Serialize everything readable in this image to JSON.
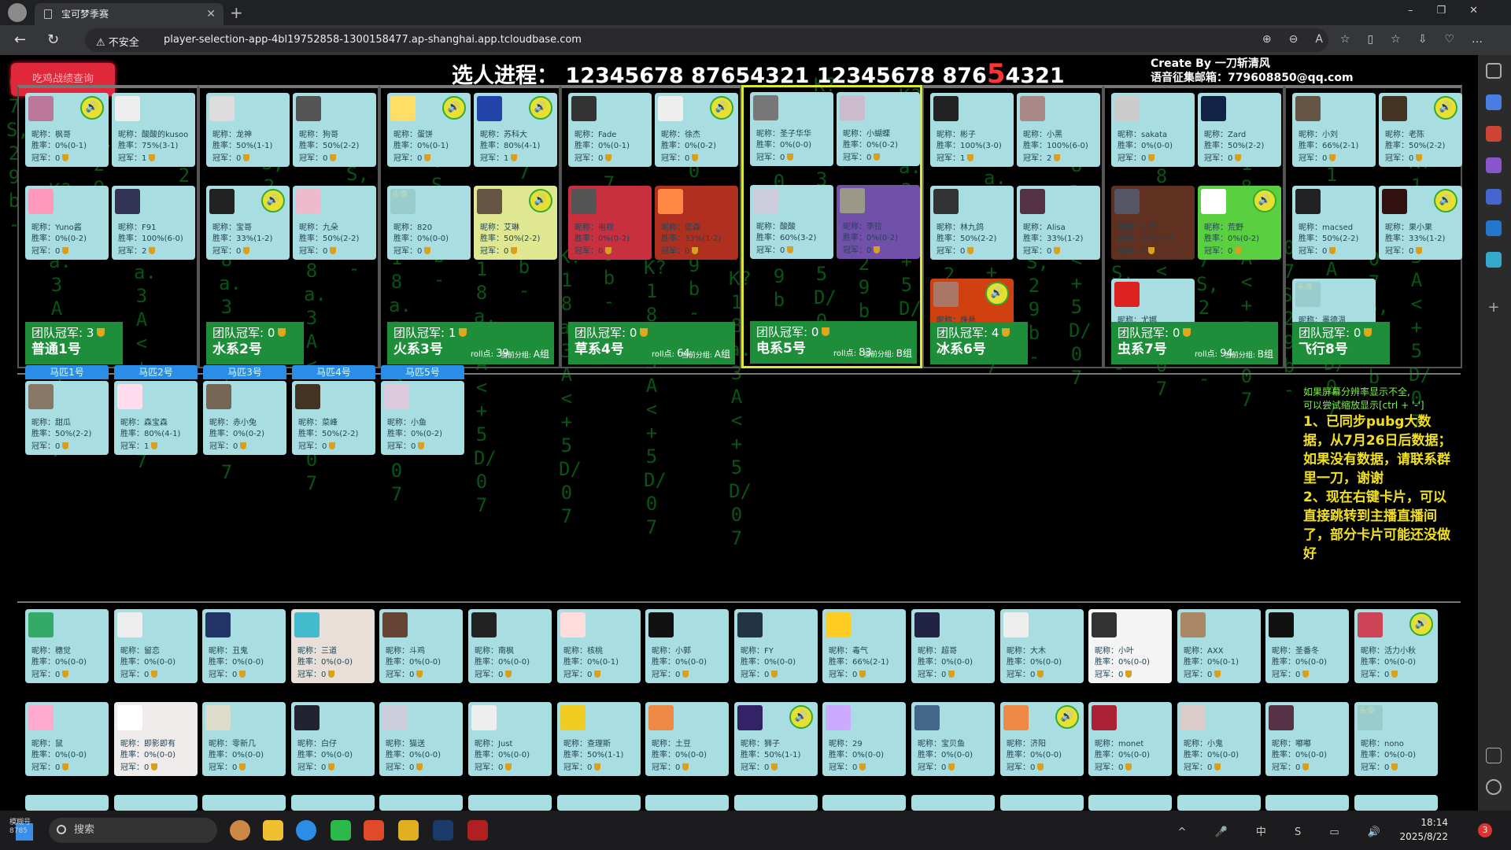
{
  "browser": {
    "tab_title": "宝可梦季赛",
    "insecure_label": "不安全",
    "url": "player-selection-app-4bl19752858-1300158477.ap-shanghai.app.tcloudbase.com"
  },
  "page": {
    "query_button": "吃鸡战绩查询",
    "progress_label": "选人进程：",
    "progress_a": "12345678 87654321 12345678 876",
    "progress_b": "5",
    "progress_c": "4321",
    "credit_1": "Create By 一刀斩清风",
    "credit_2": "语音征集邮箱：779608850@qq.com",
    "stat_labels": {
      "nick": "昵称：",
      "win": "胜率：",
      "champ": "冠军："
    },
    "roll_label": "roll点:",
    "group_label": "当前分组:"
  },
  "teams": [
    {
      "champ": "团队冠军: 3",
      "name": "普通1号",
      "roll": "",
      "group": "",
      "cards": [
        {
          "nick": "枫哥",
          "win": "0%(0-1)",
          "champ": "0",
          "av": "#b79",
          "spk": true
        },
        {
          "nick": "酸酸的kusoo",
          "win": "75%(3-1)",
          "champ": "1",
          "av": "#eee"
        },
        {
          "nick": "Yuno酱",
          "win": "0%(0-2)",
          "champ": "0",
          "av": "#f9b"
        },
        {
          "nick": "F91",
          "win": "100%(6-0)",
          "champ": "2",
          "av": "#335"
        }
      ]
    },
    {
      "champ": "团队冠军: 0",
      "name": "水系2号",
      "roll": "",
      "group": "",
      "cards": [
        {
          "nick": "龙神",
          "win": "50%(1-1)",
          "champ": "0",
          "av": "#ddd"
        },
        {
          "nick": "狗哥",
          "win": "50%(2-2)",
          "champ": "0",
          "av": "#555"
        },
        {
          "nick": "宝哥",
          "win": "33%(1-2)",
          "champ": "0",
          "av": "#222",
          "spk": true
        },
        {
          "nick": "九朵",
          "win": "50%(2-2)",
          "champ": "0",
          "av": "#ebc"
        }
      ]
    },
    {
      "champ": "团队冠军: 1",
      "name": "火系3号",
      "roll": "39",
      "group": "A组",
      "cards": [
        {
          "nick": "蛋饼",
          "win": "0%(0-1)",
          "champ": "0",
          "av": "#fd6",
          "spk": true
        },
        {
          "nick": "苏科大",
          "win": "80%(4-1)",
          "champ": "1",
          "av": "#24a",
          "spk": true
        },
        {
          "nick": "820",
          "win": "0%(0-0)",
          "champ": "0",
          "av": "#9cc",
          "ph": "头像"
        },
        {
          "nick": "艾琳",
          "win": "50%(2-2)",
          "champ": "0",
          "av": "#654",
          "spk": true,
          "bg": "#dfe890"
        }
      ]
    },
    {
      "champ": "团队冠军: 0",
      "name": "草系4号",
      "roll": "64",
      "group": "A组",
      "cards": [
        {
          "nick": "Fade",
          "win": "0%(0-1)",
          "champ": "0",
          "av": "#333"
        },
        {
          "nick": "徐杰",
          "win": "0%(0-2)",
          "champ": "0",
          "av": "#eee",
          "spk": true
        },
        {
          "nick": "电视",
          "win": "0%(0-2)",
          "champ": "0",
          "av": "#555",
          "bg": "#c83040"
        },
        {
          "nick": "蓝森",
          "win": "33%(1-2)",
          "champ": "0",
          "av": "#f84",
          "bg": "#b03020"
        }
      ]
    },
    {
      "champ": "团队冠军: 0",
      "name": "电系5号",
      "roll": "83",
      "group": "B组",
      "active": true,
      "cards": [
        {
          "nick": "圣子华华",
          "win": "0%(0-0)",
          "champ": "0",
          "av": "#777"
        },
        {
          "nick": "小蝴蝶",
          "win": "0%(0-2)",
          "champ": "0",
          "av": "#cbc"
        },
        {
          "nick": "酸酸",
          "win": "60%(3-2)",
          "champ": "0",
          "av": "#ccd"
        },
        {
          "nick": "李拉",
          "win": "0%(0-2)",
          "champ": "0",
          "av": "#998",
          "bg": "#7050a8"
        }
      ]
    },
    {
      "champ": "团队冠军: 4",
      "name": "冰系6号",
      "roll": "",
      "group": "",
      "cards": [
        {
          "nick": "彬子",
          "win": "100%(3-0)",
          "champ": "1",
          "av": "#222"
        },
        {
          "nick": "小黑",
          "win": "100%(6-0)",
          "champ": "2",
          "av": "#a88"
        },
        {
          "nick": "林九鸽",
          "win": "50%(2-2)",
          "champ": "0",
          "av": "#333"
        },
        {
          "nick": "Alisa",
          "win": "33%(1-2)",
          "champ": "0",
          "av": "#534"
        },
        {
          "nick": "烽悬",
          "win": "",
          "champ": "",
          "av": "#a76",
          "spk": true,
          "bg": "#d04010"
        }
      ]
    },
    {
      "champ": "团队冠军: 0",
      "name": "虫系7号",
      "roll": "94",
      "group": "B组",
      "cards": [
        {
          "nick": "sakata",
          "win": "0%(0-0)",
          "champ": "0",
          "av": "#ccc"
        },
        {
          "nick": "Zard",
          "win": "50%(2-2)",
          "champ": "0",
          "av": "#124"
        },
        {
          "nick": "小芳",
          "win": "0%(0-2)",
          "champ": "0",
          "av": "#556",
          "bg": "#603020"
        },
        {
          "nick": "荒野",
          "win": "0%(0-2)",
          "champ": "0",
          "av": "#fff",
          "spk": true,
          "bg": "#5ad040"
        },
        {
          "nick": "尤娜",
          "win": "",
          "champ": "",
          "av": "#d22"
        }
      ]
    },
    {
      "champ": "团队冠军: 0",
      "name": "飞行8号",
      "roll": "",
      "group": "",
      "cards": [
        {
          "nick": "小刘",
          "win": "66%(2-1)",
          "champ": "0",
          "av": "#654"
        },
        {
          "nick": "老陈",
          "win": "50%(2-2)",
          "champ": "0",
          "av": "#432",
          "spk": true
        },
        {
          "nick": "macsed",
          "win": "50%(2-2)",
          "champ": "0",
          "av": "#222"
        },
        {
          "nick": "果小果",
          "win": "33%(1-2)",
          "champ": "0",
          "av": "#311",
          "spk": true
        },
        {
          "nick": "墨德温",
          "win": "",
          "champ": "",
          "av": "#9cc",
          "ph": "头像"
        }
      ]
    }
  ],
  "horses": [
    {
      "tab": "马匹1号",
      "nick": "甜瓜",
      "win": "50%(2-2)",
      "champ": "0",
      "av": "#876"
    },
    {
      "tab": "马匹2号",
      "nick": "森宝森",
      "win": "80%(4-1)",
      "champ": "1",
      "av": "#fde"
    },
    {
      "tab": "马匹3号",
      "nick": "赤小兔",
      "win": "0%(0-2)",
      "champ": "0",
      "av": "#765"
    },
    {
      "tab": "马匹4号",
      "nick": "菜峰",
      "win": "50%(2-2)",
      "champ": "0",
      "av": "#432"
    },
    {
      "tab": "马匹5号",
      "nick": "小鱼",
      "win": "0%(0-2)",
      "champ": "0",
      "av": "#dcd"
    }
  ],
  "notice": {
    "hint_1": "如果屏幕分辨率显示不全,",
    "hint_2": "可以尝试缩放显示[ctrl + '-']",
    "p1": "1、已同步pubg大数据，从7月26日后数据；",
    "p2": "如果没有数据，请联系群里一刀，谢谢",
    "p3": "2、现在右键卡片，可以直接跳转到主播直播间了，部分卡片可能还没做好"
  },
  "pool": [
    [
      {
        "nick": "穗觉",
        "win": "0%(0-0)",
        "champ": "0",
        "av": "#3a6"
      },
      {
        "nick": "留恋",
        "win": "0%(0-0)",
        "champ": "0",
        "av": "#eee"
      },
      {
        "nick": "丑鬼",
        "win": "0%(0-0)",
        "champ": "0",
        "av": "#236"
      },
      {
        "nick": "三道",
        "win": "0%(0-0)",
        "champ": "0",
        "av": "#4bc",
        "bg": "#e8e0d8"
      },
      {
        "nick": "斗鸡",
        "win": "0%(0-0)",
        "champ": "0",
        "av": "#643"
      },
      {
        "nick": "南枫",
        "win": "0%(0-0)",
        "champ": "0",
        "av": "#222"
      },
      {
        "nick": "核桃",
        "win": "0%(0-1)",
        "champ": "0",
        "av": "#fdd"
      },
      {
        "nick": "小郭",
        "win": "0%(0-0)",
        "champ": "0",
        "av": "#111"
      },
      {
        "nick": "FY",
        "win": "0%(0-0)",
        "champ": "0",
        "av": "#234"
      },
      {
        "nick": "毒气",
        "win": "66%(2-1)",
        "champ": "0",
        "av": "#fc2"
      },
      {
        "nick": "超哥",
        "win": "0%(0-0)",
        "champ": "0",
        "av": "#224"
      },
      {
        "nick": "大木",
        "win": "0%(0-0)",
        "champ": "0",
        "av": "#eee"
      },
      {
        "nick": "小叶",
        "win": "0%(0-0)",
        "champ": "0",
        "av": "#333",
        "bg": "#f4f4f4"
      },
      {
        "nick": "AXX",
        "win": "0%(0-1)",
        "champ": "0",
        "av": "#a86"
      },
      {
        "nick": "圣番冬",
        "win": "0%(0-0)",
        "champ": "0",
        "av": "#111"
      },
      {
        "nick": "活力小秋",
        "win": "0%(0-0)",
        "champ": "0",
        "av": "#c45",
        "spk": true
      }
    ],
    [
      {
        "nick": "鼠",
        "win": "0%(0-0)",
        "champ": "0",
        "av": "#fac"
      },
      {
        "nick": "即影即有",
        "win": "0%(0-0)",
        "champ": "0",
        "av": "#fff",
        "bg": "#f0ecec"
      },
      {
        "nick": "零新几",
        "win": "0%(0-0)",
        "champ": "0",
        "av": "#ddc"
      },
      {
        "nick": "白仔",
        "win": "0%(0-0)",
        "champ": "0",
        "av": "#223"
      },
      {
        "nick": "猫送",
        "win": "0%(0-0)",
        "champ": "0",
        "av": "#ccd"
      },
      {
        "nick": "Just",
        "win": "0%(0-0)",
        "champ": "0",
        "av": "#eee"
      },
      {
        "nick": "查理斯",
        "win": "50%(1-1)",
        "champ": "0",
        "av": "#ec2"
      },
      {
        "nick": "土豆",
        "win": "0%(0-0)",
        "champ": "0",
        "av": "#e84"
      },
      {
        "nick": "狮子",
        "win": "50%(1-1)",
        "champ": "0",
        "av": "#326",
        "spk": true
      },
      {
        "nick": "29",
        "win": "0%(0-0)",
        "champ": "0",
        "av": "#caf"
      },
      {
        "nick": "宝贝鱼",
        "win": "0%(0-0)",
        "champ": "0",
        "av": "#468"
      },
      {
        "nick": "济阳",
        "win": "0%(0-0)",
        "champ": "0",
        "av": "#e84",
        "spk": true
      },
      {
        "nick": "monet",
        "win": "0%(0-0)",
        "champ": "0",
        "av": "#a23"
      },
      {
        "nick": "小鬼",
        "win": "0%(0-0)",
        "champ": "0",
        "av": "#dcc"
      },
      {
        "nick": "嘟嘟",
        "win": "0%(0-0)",
        "champ": "0",
        "av": "#534"
      },
      {
        "nick": "nono",
        "win": "0%(0-0)",
        "champ": "0",
        "av": "#9cc",
        "ph": "头像"
      }
    ]
  ],
  "taskbar": {
    "search": "搜索",
    "ime": "中",
    "time": "18:14",
    "date": "2025/8/22",
    "notif": "3",
    "win_label_1": "模糊号",
    "win_label_2": "8785"
  },
  "colors": {
    "card": "#a8dde2",
    "team_label": "#1f8e3a",
    "active_border": "#dde830",
    "query_button": "#e0283a",
    "horse_tab": "#2a8ee8"
  }
}
